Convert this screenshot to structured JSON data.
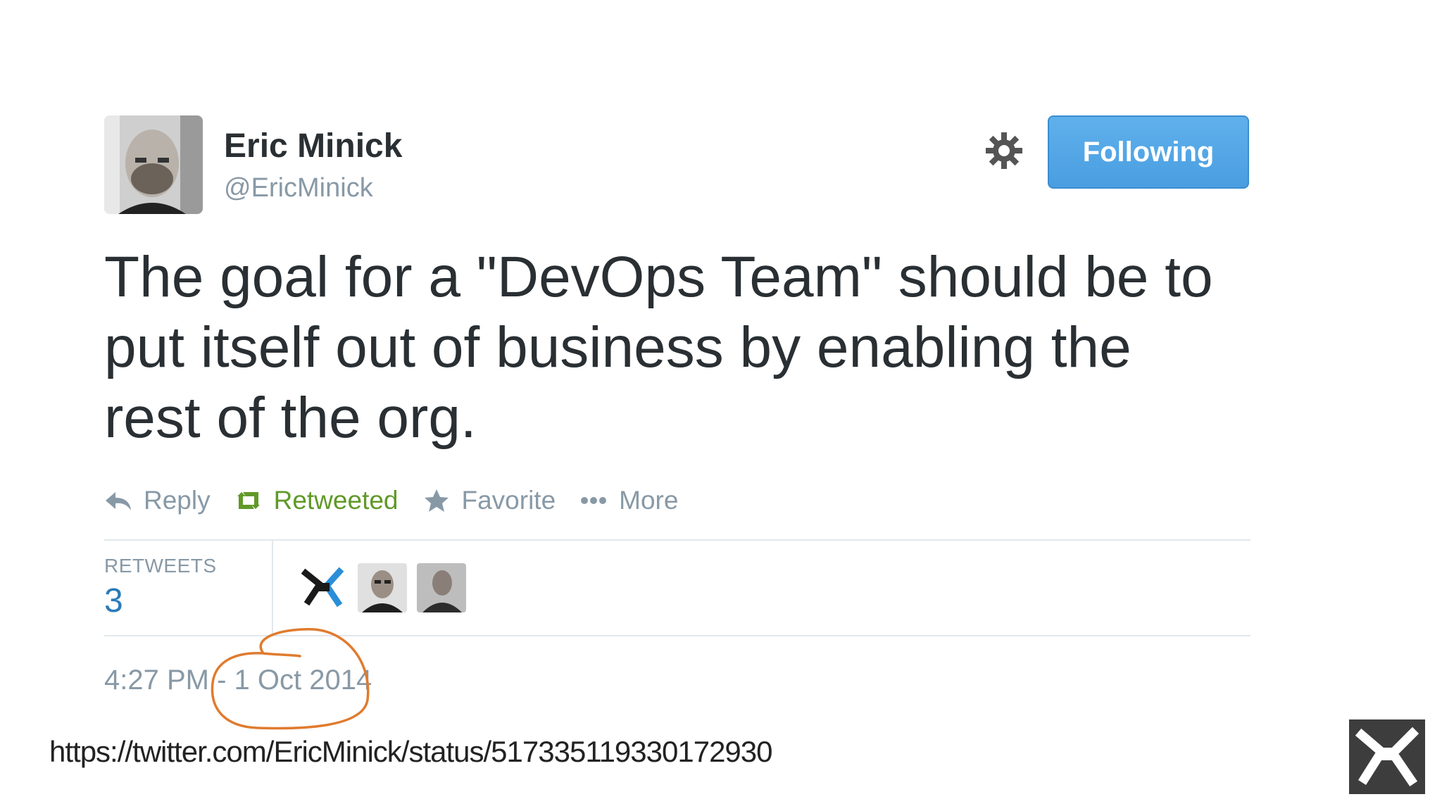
{
  "author": {
    "name": "Eric Minick",
    "handle": "@EricMinick"
  },
  "follow_button": {
    "label": "Following",
    "color": "#55acee"
  },
  "tweet": {
    "text": "The goal for a \"DevOps Team\" should be to\nput itself out of business by enabling the\nrest of the org."
  },
  "actions": [
    {
      "label": "Reply",
      "icon": "reply-icon"
    },
    {
      "label": "Retweeted",
      "icon": "retweet-icon",
      "color": "#609928"
    },
    {
      "label": "Favorite",
      "icon": "star-icon"
    },
    {
      "label": "More",
      "icon": "ellipsis-icon"
    }
  ],
  "stats": {
    "retweets_label": "RETWEETS",
    "retweets_count": "3"
  },
  "timestamp": "4:27 PM - 1 Oct 2014",
  "annotation_color": "#e07b2e",
  "source_url": "https://twitter.com/EricMinick/status/517335119330172930"
}
